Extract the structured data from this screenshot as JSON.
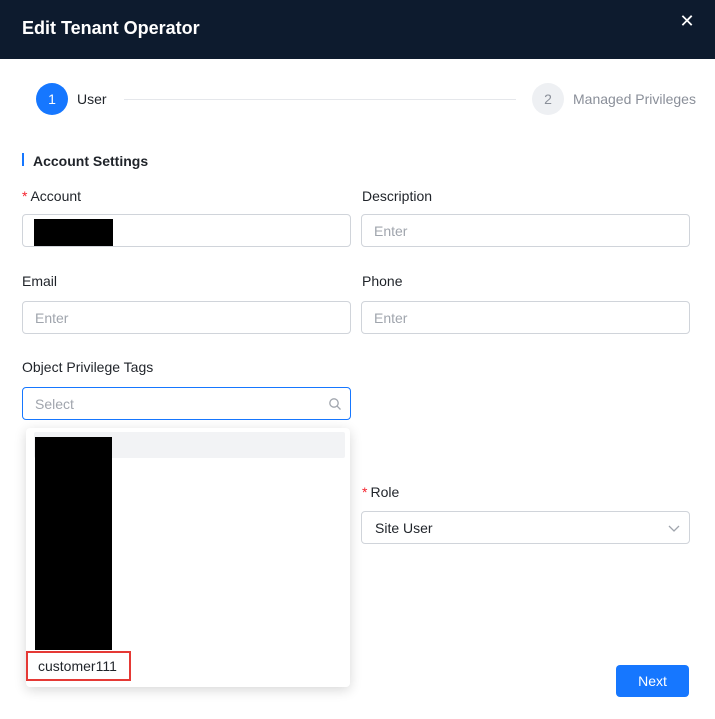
{
  "dialog": {
    "title": "Edit Tenant Operator",
    "close_icon": "close-icon",
    "close_glyph": "✕"
  },
  "steps": [
    {
      "number": "1",
      "label": "User",
      "state": "active"
    },
    {
      "number": "2",
      "label": "Managed Privileges",
      "state": "inactive"
    }
  ],
  "section": {
    "title": "Account Settings"
  },
  "form": {
    "account": {
      "label": "Account",
      "required": "*",
      "value": ""
    },
    "description": {
      "label": "Description",
      "placeholder": "Enter"
    },
    "email": {
      "label": "Email",
      "placeholder": "Enter"
    },
    "phone": {
      "label": "Phone",
      "placeholder": "Enter"
    },
    "object_privilege_tags": {
      "label": "Object Privilege Tags",
      "placeholder": "Select",
      "icon": "search-icon"
    },
    "role": {
      "label": "Role",
      "required": "*",
      "value": "Site User",
      "icon": "chevron-down-icon"
    }
  },
  "dropdown": {
    "options": [
      {
        "label": "customer111",
        "highlighted": true
      }
    ]
  },
  "footer": {
    "next_label": "Next"
  },
  "colors": {
    "header_bg": "#0d1b2e",
    "accent": "#1677ff",
    "required": "#f5222d",
    "highlight_box": "#e53935"
  }
}
